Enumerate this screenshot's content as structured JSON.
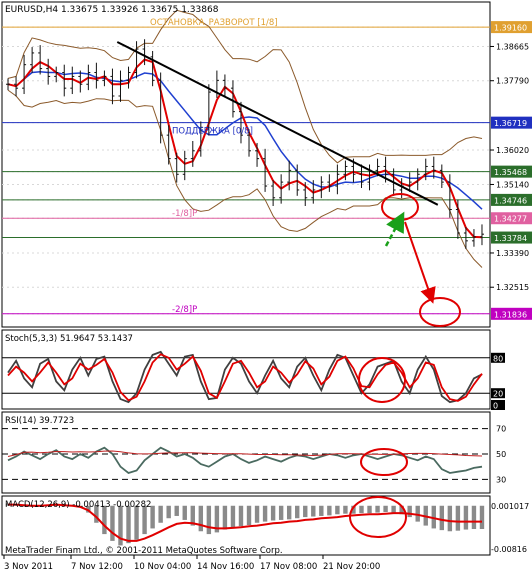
{
  "colors": {
    "price": "#111111",
    "ma_red": "#e00000",
    "ma_blue": "#2040d0",
    "bands": "#8b5a2b",
    "trendline": "#000000",
    "circle": "#e00000",
    "arrow_red": "#e00000",
    "arrow_green": "#1aa01a",
    "level_orange": "#e0a030",
    "level_blue": "#2030c0",
    "level_green": "#2b6e2b",
    "level_pink": "#e060a0",
    "level_magenta": "#c000c0"
  },
  "main": {
    "header": "EURUSD,H4  1.33675 1.33926 1.33675 1.33868",
    "level_labels": {
      "stop_reversal": "ОСТАНОВКА_РАЗВОРОТ [1/8]",
      "support": "ПОДДЕРЖКА [0/8]",
      "minus_one": "-1/8]P",
      "minus_two": "-2/8]P"
    }
  },
  "stoch": {
    "header": "Stoch(5,3,3) 51.9647 53.1437",
    "levels": [
      "80",
      "20",
      "0"
    ]
  },
  "rsi": {
    "header": "RSI(14) 39.7723",
    "levels": [
      "70",
      "50",
      "30"
    ]
  },
  "macd": {
    "header": "MACD(12,26,9) -0.00413 -0.00282",
    "levels": [
      "0.001017",
      "-0.00816"
    ]
  },
  "copyright": "MetaTrader Finam Ltd., © 2001-2011 MetaQuotes Software Corp.",
  "chart_data": [
    {
      "type": "line",
      "title": "EURUSD,H4",
      "y_ticks": [
        "1.39160",
        "1.38665",
        "1.37790",
        "1.36719",
        "1.36020",
        "1.35468",
        "1.35140",
        "1.34746",
        "1.34277",
        "1.33784",
        "1.33390",
        "1.32515",
        "1.31836"
      ],
      "highlight_ticks": [
        "1.39160",
        "1.36719",
        "1.35468",
        "1.34746",
        "1.34277",
        "1.33784",
        "1.31836"
      ],
      "ylim": [
        1.3155,
        1.3975
      ],
      "x_ticks": [
        "3 Nov 2011",
        "7 Nov 12:00",
        "10 Nov 04:00",
        "14 Nov 16:00",
        "17 Nov 08:00",
        "21 Nov 20:00"
      ],
      "levels": [
        {
          "value": 1.3916,
          "label": "ОСТАНОВКА_РАЗВОРОТ [1/8]"
        },
        {
          "value": 1.36719,
          "label": "ПОДДЕРЖКА [0/8]"
        },
        {
          "value": 1.35468
        },
        {
          "value": 1.34746
        },
        {
          "value": 1.34277,
          "label": "-1/8]P"
        },
        {
          "value": 1.33784
        },
        {
          "value": 1.31836,
          "label": "-2/8]P"
        }
      ],
      "trendline": [
        [
          0.235,
          1.3878
        ],
        [
          0.9,
          1.3462
        ]
      ],
      "close": [
        1.377,
        1.376,
        1.382,
        1.385,
        1.381,
        1.379,
        1.38,
        1.376,
        1.379,
        1.377,
        1.38,
        1.378,
        1.379,
        1.374,
        1.378,
        1.38,
        1.386,
        1.384,
        1.378,
        1.364,
        1.358,
        1.354,
        1.358,
        1.36,
        1.366,
        1.375,
        1.378,
        1.376,
        1.37,
        1.364,
        1.36,
        1.358,
        1.351,
        1.348,
        1.352,
        1.355,
        1.35,
        1.348,
        1.35,
        1.352,
        1.351,
        1.354,
        1.356,
        1.354,
        1.352,
        1.355,
        1.356,
        1.354,
        1.35,
        1.351,
        1.352,
        1.354,
        1.356,
        1.355,
        1.352,
        1.345,
        1.339,
        1.337,
        1.338,
        1.3387
      ]
    },
    {
      "type": "line",
      "title": "Stoch(5,3,3)",
      "ylim": [
        0,
        100
      ],
      "series": [
        {
          "values": [
            55,
            75,
            45,
            30,
            70,
            78,
            40,
            25,
            60,
            80,
            50,
            78,
            82,
            40,
            10,
            5,
            20,
            60,
            85,
            90,
            70,
            50,
            82,
            85,
            40,
            10,
            12,
            60,
            80,
            70,
            40,
            20,
            50,
            75,
            45,
            30,
            65,
            80,
            50,
            25,
            60,
            85,
            80,
            50,
            20,
            35,
            65,
            70,
            75,
            40,
            20,
            60,
            82,
            60,
            15,
            5,
            8,
            20,
            45,
            52
          ]
        },
        {
          "values": [
            50,
            65,
            55,
            40,
            55,
            72,
            55,
            35,
            45,
            70,
            60,
            68,
            78,
            55,
            22,
            8,
            14,
            40,
            72,
            86,
            80,
            60,
            70,
            82,
            58,
            20,
            12,
            40,
            70,
            75,
            55,
            30,
            40,
            65,
            55,
            38,
            52,
            74,
            62,
            35,
            48,
            75,
            82,
            62,
            32,
            30,
            52,
            68,
            72,
            55,
            30,
            45,
            72,
            68,
            30,
            10,
            7,
            14,
            35,
            53
          ]
        }
      ]
    },
    {
      "type": "line",
      "title": "RSI(14)",
      "ylim": [
        20,
        80
      ],
      "series": [
        {
          "values": [
            45,
            48,
            52,
            49,
            46,
            50,
            53,
            48,
            46,
            50,
            47,
            52,
            55,
            50,
            40,
            35,
            37,
            45,
            50,
            55,
            52,
            48,
            50,
            47,
            42,
            40,
            44,
            48,
            50,
            46,
            43,
            45,
            48,
            46,
            44,
            47,
            49,
            48,
            46,
            48,
            50,
            49,
            47,
            49,
            50,
            48,
            46,
            48,
            50,
            49,
            47,
            45,
            48,
            46,
            38,
            35,
            36,
            37,
            39,
            40
          ]
        }
      ]
    },
    {
      "type": "bar",
      "title": "MACD(12,26,9)",
      "ylim": [
        -0.00816,
        0.001017
      ],
      "values": [
        0.0004,
        0.0003,
        0.0001,
        -0.0002,
        0.0,
        0.0002,
        0.0003,
        0.0001,
        -0.0001,
        -0.0003,
        -0.0012,
        -0.003,
        -0.005,
        -0.0062,
        -0.007,
        -0.0066,
        -0.006,
        -0.005,
        -0.004,
        -0.003,
        -0.0022,
        -0.0018,
        -0.0025,
        -0.0035,
        -0.0045,
        -0.005,
        -0.0047,
        -0.0042,
        -0.0038,
        -0.0036,
        -0.0034,
        -0.003,
        -0.0028,
        -0.0026,
        -0.0025,
        -0.0024,
        -0.0022,
        -0.002,
        -0.0019,
        -0.0018,
        -0.0017,
        -0.0015,
        -0.0014,
        -0.0014,
        -0.0013,
        -0.0013,
        -0.0012,
        -0.0011,
        -0.0012,
        -0.0015,
        -0.002,
        -0.0028,
        -0.0035,
        -0.004,
        -0.0043,
        -0.0045,
        -0.0044,
        -0.0042,
        -0.0041,
        -0.0041
      ],
      "series": [
        {
          "values": [
            0.0002,
            0.0002,
            0.0001,
            0.0,
            0.0,
            0.0001,
            0.0002,
            0.0001,
            0.0,
            -0.0002,
            -0.0008,
            -0.002,
            -0.0035,
            -0.0048,
            -0.0058,
            -0.0062,
            -0.0062,
            -0.0058,
            -0.0052,
            -0.0045,
            -0.0038,
            -0.0032,
            -0.003,
            -0.0031,
            -0.0034,
            -0.0038,
            -0.004,
            -0.004,
            -0.0039,
            -0.0038,
            -0.0036,
            -0.0035,
            -0.0033,
            -0.0031,
            -0.003,
            -0.0028,
            -0.0027,
            -0.0025,
            -0.0024,
            -0.0022,
            -0.0021,
            -0.002,
            -0.0018,
            -0.0017,
            -0.0016,
            -0.0015,
            -0.0015,
            -0.0014,
            -0.0013,
            -0.0013,
            -0.0014,
            -0.0016,
            -0.0019,
            -0.0022,
            -0.0025,
            -0.0027,
            -0.0028,
            -0.0028,
            -0.0028,
            -0.0028
          ]
        }
      ]
    }
  ]
}
